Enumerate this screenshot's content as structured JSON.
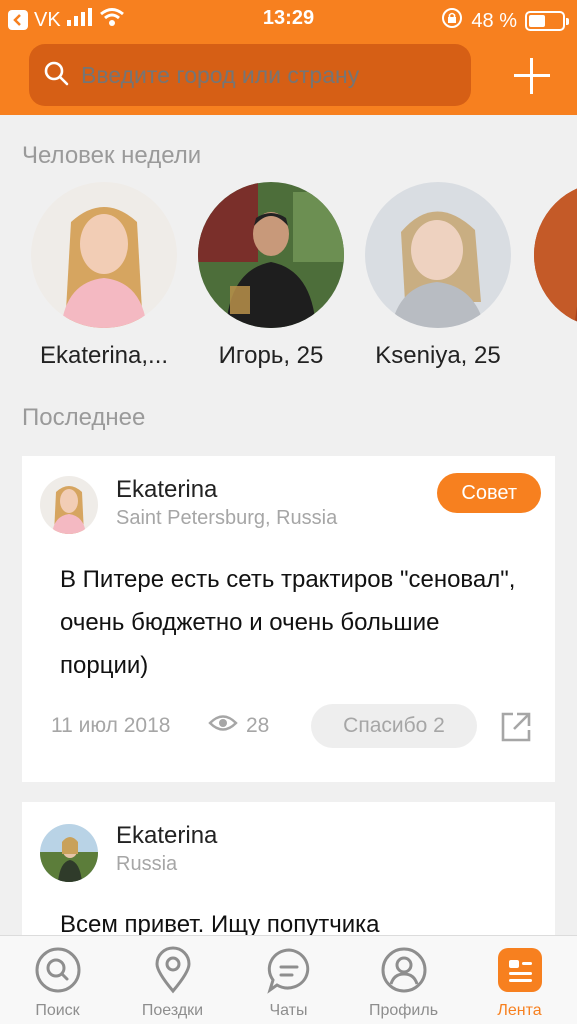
{
  "colors": {
    "accent": "#f7801f",
    "search_bg": "#d65f15",
    "muted": "#a6a6a6"
  },
  "status_bar": {
    "back_app": "VK",
    "time": "13:29",
    "battery": "48 %",
    "battery_level": 0.48
  },
  "search": {
    "placeholder": "Введите город или страну",
    "icon": "search-icon"
  },
  "sections": {
    "week_people": "Человек недели",
    "latest": "Последнее"
  },
  "people": [
    {
      "name": "Ekaterina,..."
    },
    {
      "name": "Игорь, 25"
    },
    {
      "name": "Kseniya, 25"
    }
  ],
  "posts": [
    {
      "author": "Ekaterina",
      "location": "Saint Petersburg, Russia",
      "badge": "Совет",
      "text": "В Питере есть сеть трактиров \"сеновал\", очень бюджетно и очень большие порции)",
      "date": "11 июл 2018",
      "views": "28",
      "thanks": "Спасибо 2"
    },
    {
      "author": "Ekaterina",
      "location": "Russia",
      "text": "Всем привет. Ищу попутчика"
    }
  ],
  "tabs": [
    {
      "label": "Поиск",
      "icon": "search-circle-icon",
      "active": false
    },
    {
      "label": "Поездки",
      "icon": "location-pin-icon",
      "active": false
    },
    {
      "label": "Чаты",
      "icon": "chat-bubble-icon",
      "active": false
    },
    {
      "label": "Профиль",
      "icon": "profile-icon",
      "active": false
    },
    {
      "label": "Лента",
      "icon": "feed-icon",
      "active": true
    }
  ]
}
